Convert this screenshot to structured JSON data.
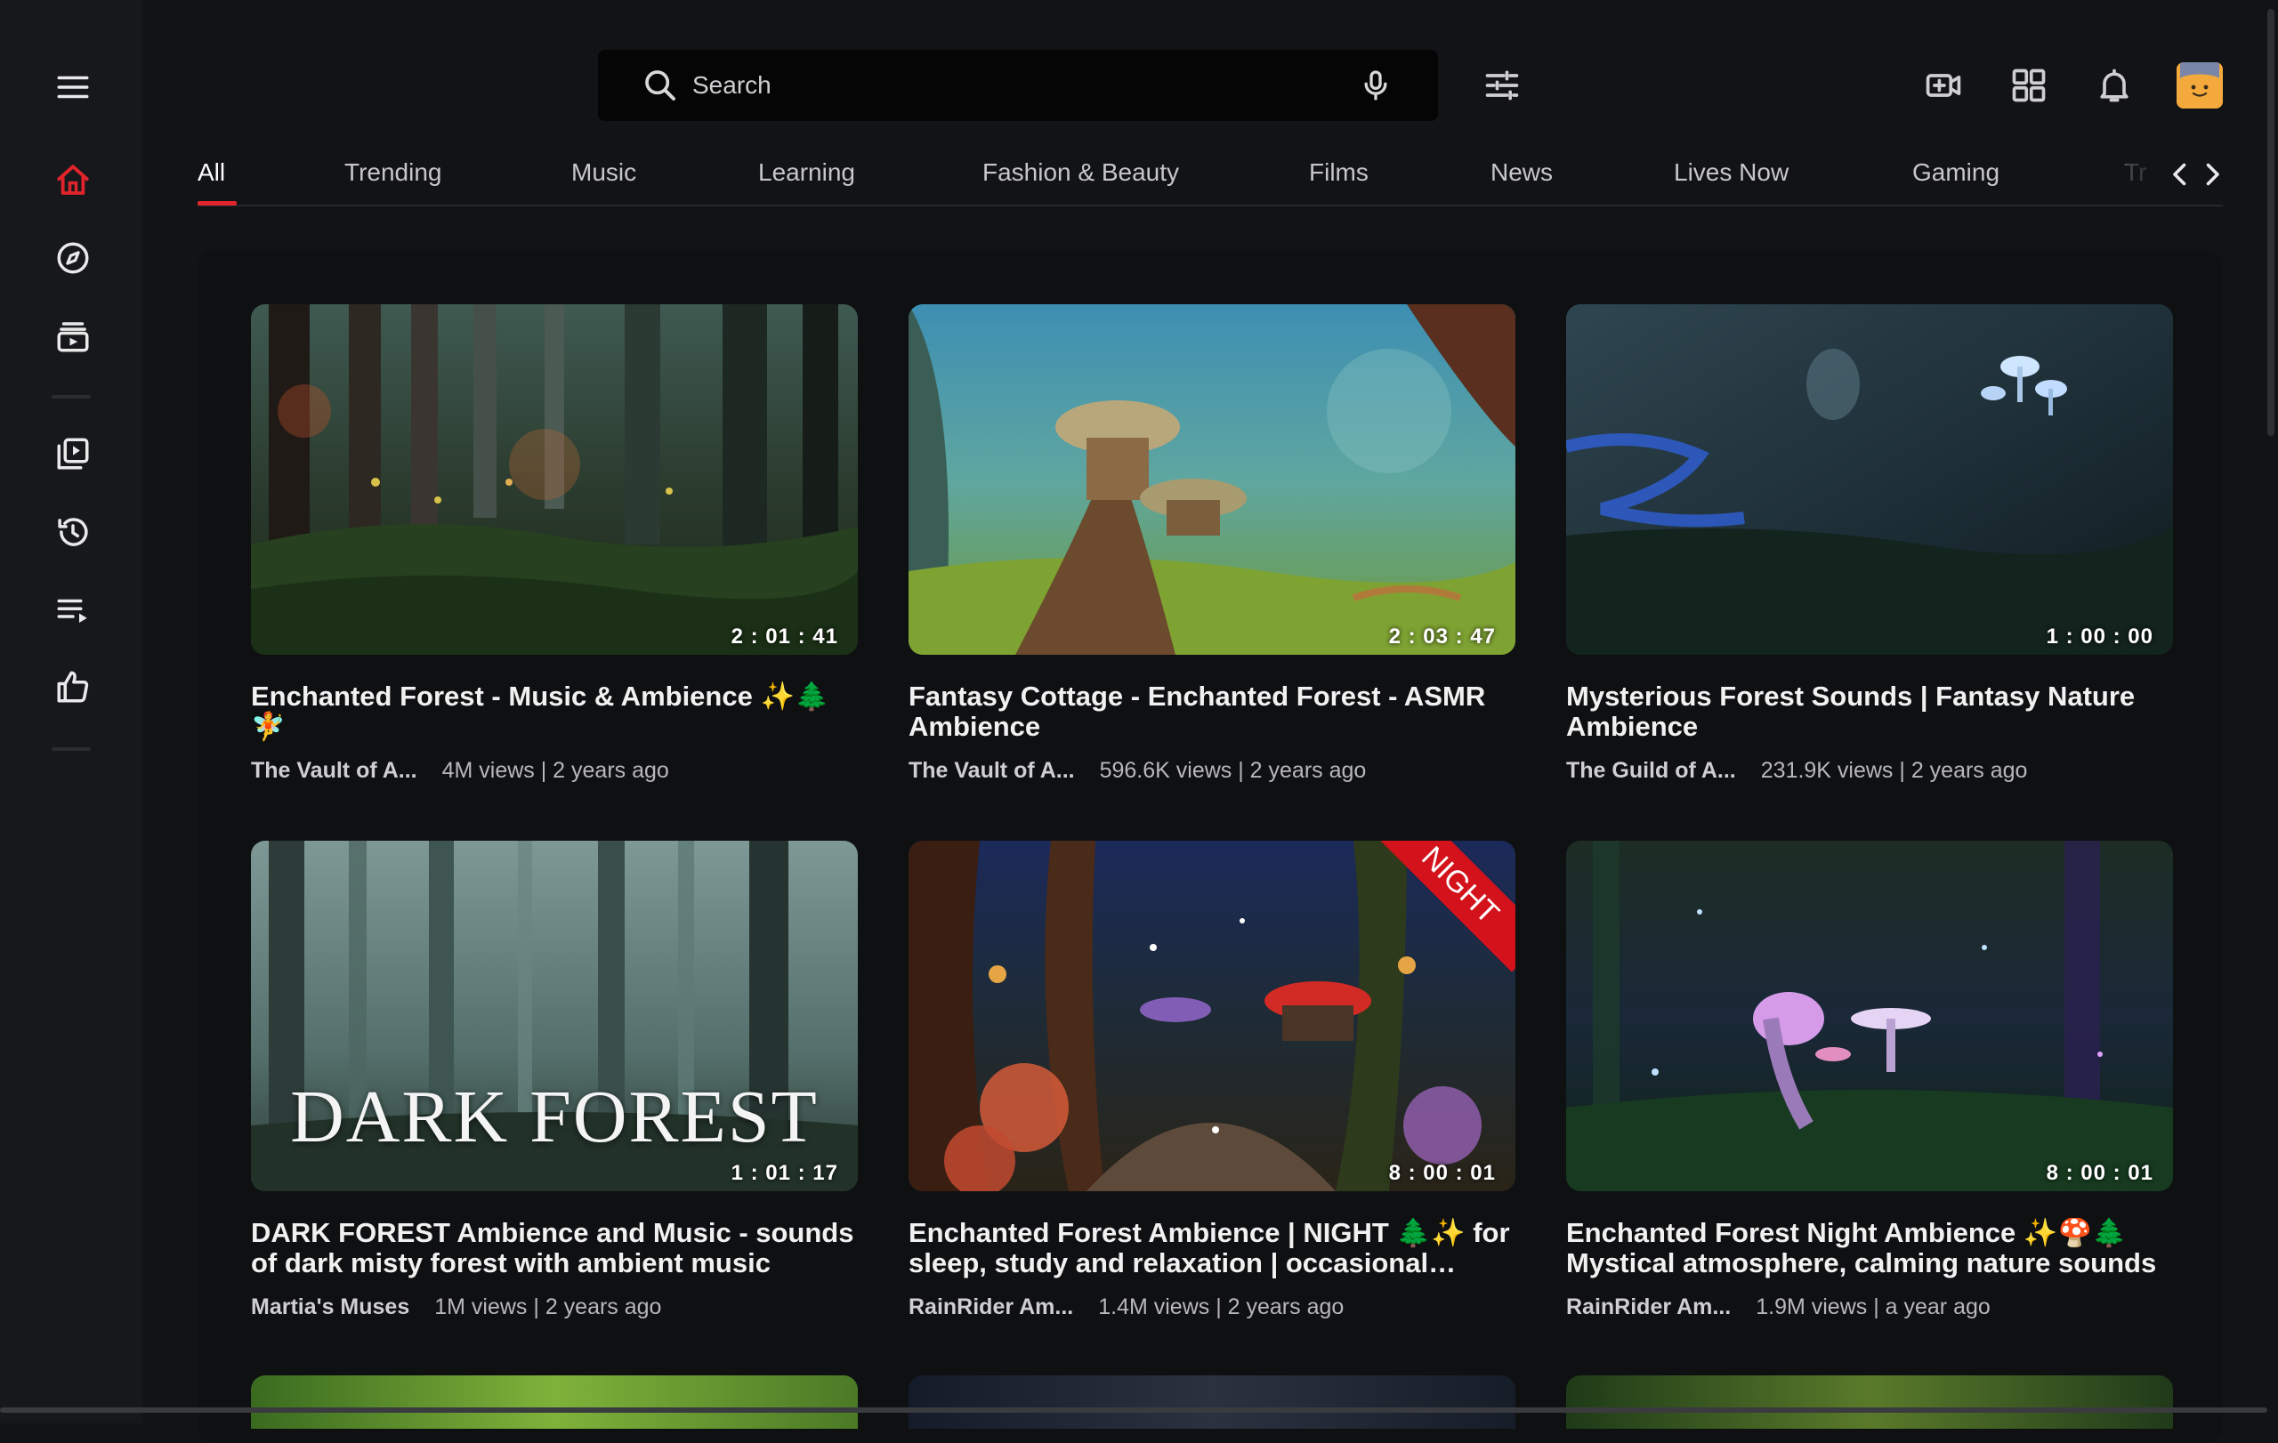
{
  "search": {
    "placeholder": "Search"
  },
  "chips": [
    "All",
    "Trending",
    "Music",
    "Learning",
    "Fashion & Beauty",
    "Films",
    "News",
    "Lives Now",
    "Gaming",
    "Tr"
  ],
  "accent_color": "#e0242c",
  "videos": [
    {
      "title": "Enchanted Forest - Music & Ambience ✨🌲🧚",
      "channel": "The Vault of A...",
      "stats": "4M views | 2 years ago",
      "duration": "2 : 01 : 41"
    },
    {
      "title": "Fantasy Cottage - Enchanted Forest - ASMR Ambience",
      "channel": "The Vault of A...",
      "stats": "596.6K views | 2 years ago",
      "duration": "2 : 03 : 47"
    },
    {
      "title": "Mysterious Forest Sounds | Fantasy Nature Ambience",
      "channel": "The Guild of A...",
      "stats": "231.9K views | 2 years ago",
      "duration": "1 : 00 : 00"
    },
    {
      "title": "DARK FOREST Ambience and Music - sounds of dark misty forest with ambient music",
      "channel": "Martia's Muses",
      "stats": "1M views | 2 years ago",
      "duration": "1 : 01 : 17",
      "thumb_text": "DARK FOREST"
    },
    {
      "title": "Enchanted Forest Ambience | NIGHT 🌲✨ for sleep, study and relaxation | occasional music",
      "channel": "RainRider Am...",
      "stats": "1.4M views | 2 years ago",
      "duration": "8 : 00 : 01",
      "badge": "NIGHT"
    },
    {
      "title": "Enchanted Forest Night Ambience ✨🍄🌲 Mystical atmosphere, calming nature sounds",
      "channel": "RainRider Am...",
      "stats": "1.9M views | a year ago",
      "duration": "8 : 00 : 01"
    }
  ],
  "icons": {
    "sidebar": [
      "menu-icon",
      "home-icon",
      "explore-icon",
      "subscriptions-icon",
      "library-icon",
      "history-icon",
      "watch-later-icon",
      "liked-videos-icon"
    ],
    "topbar": [
      "search-icon",
      "microphone-icon",
      "filter-icon",
      "create-video-icon",
      "apps-grid-icon",
      "notifications-bell-icon"
    ]
  }
}
